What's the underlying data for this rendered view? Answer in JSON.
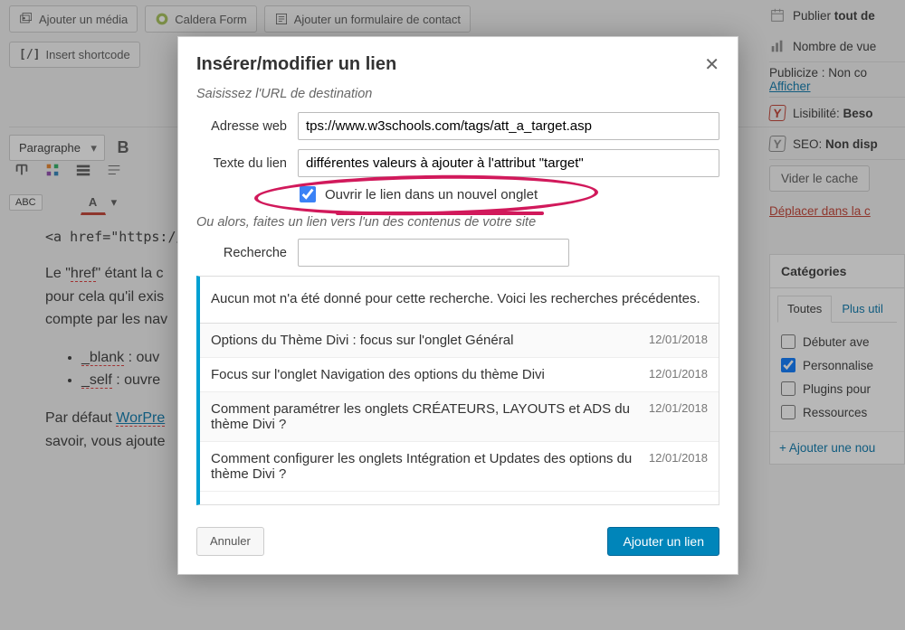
{
  "topbar": {
    "add_media": "Ajouter un média",
    "caldera": "Caldera Form",
    "add_contact_form": "Ajouter un formulaire de contact",
    "insert_shortcode": "Insert shortcode"
  },
  "editor": {
    "para": "Paragraphe",
    "bold": "B",
    "abc": "ABC",
    "a": "A",
    "content_code": "<a href=\"https://as",
    "content_p1a": "Le \"",
    "content_p1b": "\" étant la c",
    "content_p1c": "pour cela qu'il exis",
    "content_p1d": "compte par les nav",
    "content_href": "href",
    "li1a": "_blank",
    "li1b": " : ouv",
    "li2a": "_self",
    "li2b": " : ouvre",
    "content_p2a": "Par défaut ",
    "content_p2b": "savoir, vous ajoute",
    "content_wp": "WorPre"
  },
  "sidebar": {
    "publish": "Publier ",
    "publish_bold": "tout de",
    "views": "Nombre de vue",
    "publicize_label": "Publicize : Non co",
    "show": "Afficher",
    "readability_label": "Lisibilité: ",
    "readability_bold": "Beso",
    "seo_label": "SEO: ",
    "seo_bold": "Non disp",
    "clear_cache": "Vider le cache",
    "move_trash": "Déplacer dans la c",
    "categories_title": "Catégories",
    "tab_all": "Toutes",
    "tab_used": "Plus util",
    "cat1": "Débuter ave",
    "cat2": "Personnalise",
    "cat3": "Plugins pour",
    "cat4": "Ressources",
    "add_cat": "+ Ajouter une nou"
  },
  "modal": {
    "title": "Insérer/modifier un lien",
    "hint": "Saisissez l'URL de destination",
    "url_label": "Adresse web",
    "url_value": "tps://www.w3schools.com/tags/att_a_target.asp",
    "text_label": "Texte du lien",
    "text_value": "différentes valeurs à ajouter à l'attribut \"target\"",
    "newtab": "Ouvrir le lien dans un nouvel onglet",
    "hint2": "Ou alors, faites un lien vers l'un des contenus de votre site",
    "search_label": "Recherche",
    "no_results": "Aucun mot n'a été donné pour cette recherche. Voici les recherches précédentes.",
    "results": [
      {
        "title": "Options du Thème Divi : focus sur l'onglet Général",
        "date": "12/01/2018"
      },
      {
        "title": "Focus sur l'onglet Navigation des options du thème Divi",
        "date": "12/01/2018"
      },
      {
        "title": "Comment paramétrer les onglets CRÉATEURS, LAYOUTS et ADS du thème Divi ?",
        "date": "12/01/2018"
      },
      {
        "title": "Comment configurer les onglets Intégration et Updates des options du thème Divi ?",
        "date": "12/01/2018"
      }
    ],
    "cancel": "Annuler",
    "submit": "Ajouter un lien"
  }
}
